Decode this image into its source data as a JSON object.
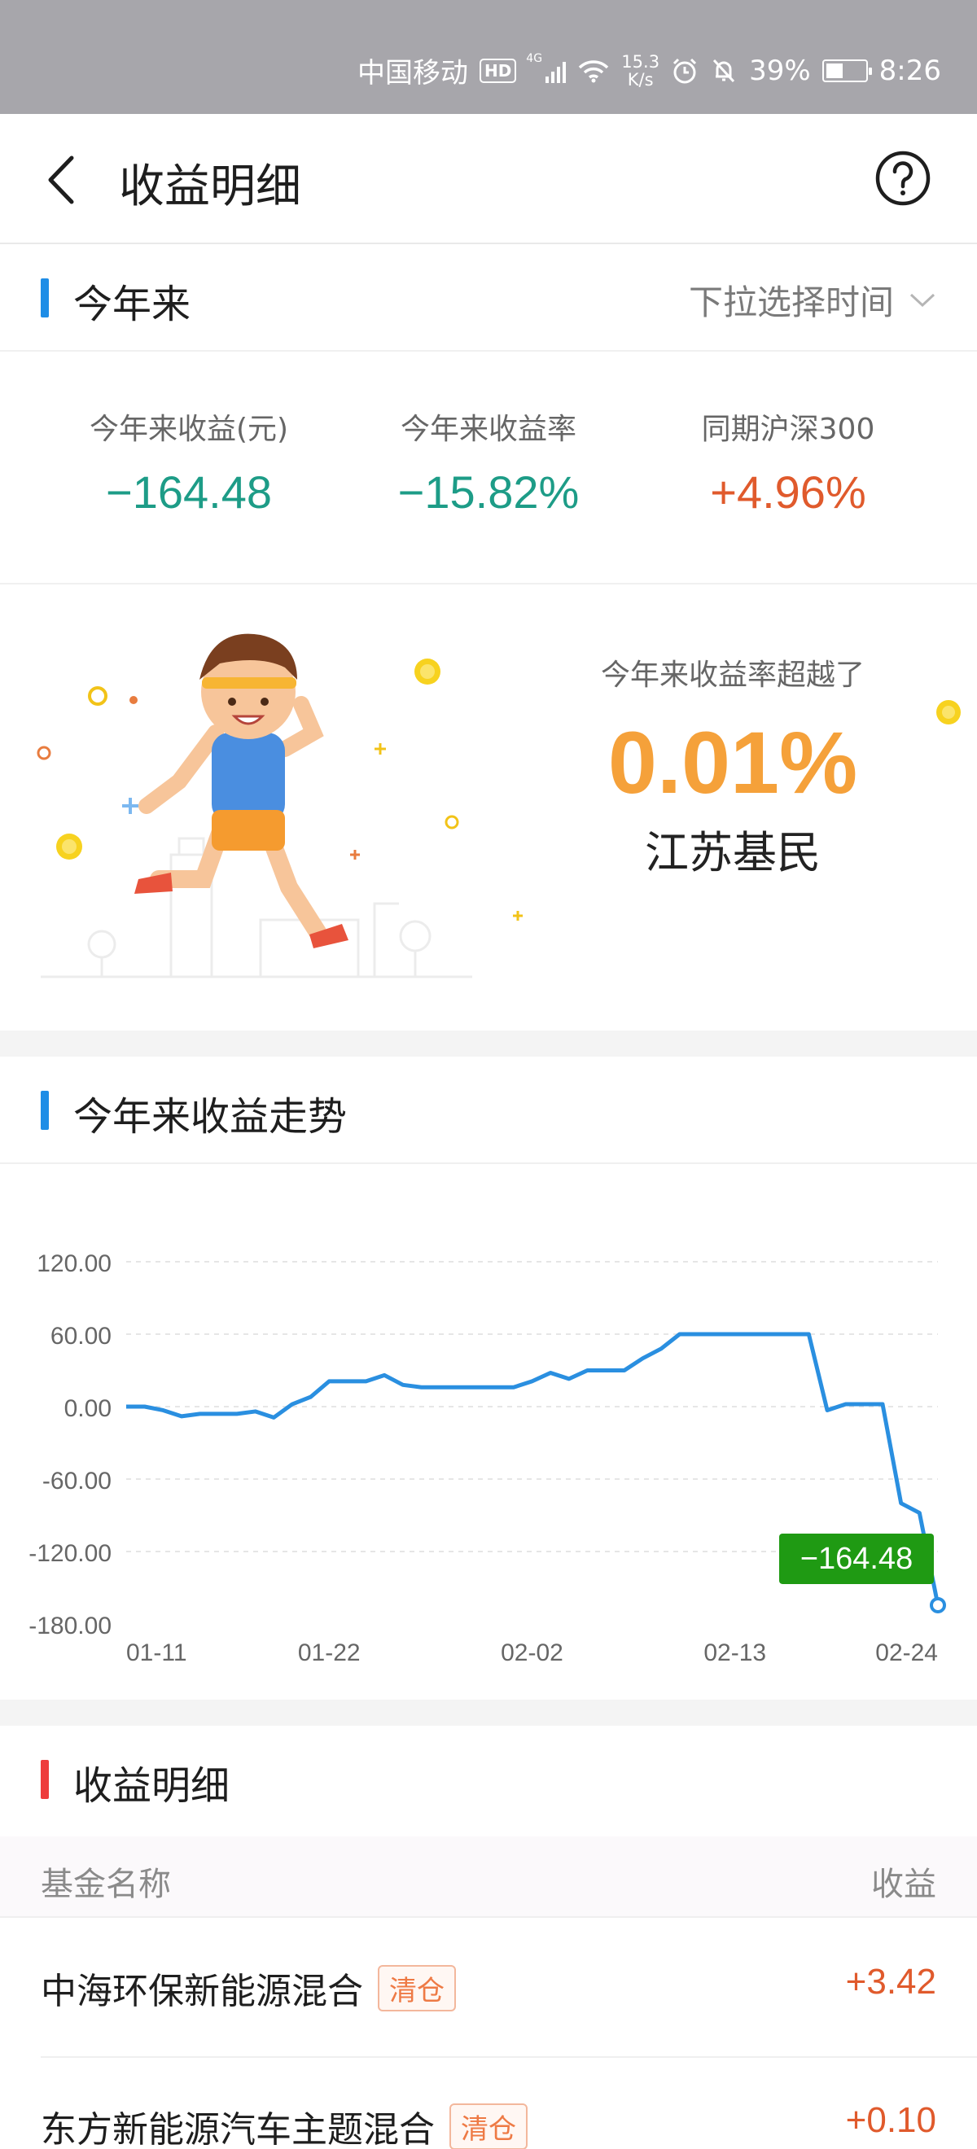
{
  "status_bar": {
    "carrier": "中国移动",
    "hd": "HD",
    "signal_tag": "4G",
    "net_speed_value": "15.3",
    "net_speed_unit": "K/s",
    "battery": "39%",
    "time": "8:26"
  },
  "nav": {
    "title": "收益明细",
    "back_icon": "chevron-left-icon",
    "help_icon": "question-circle-icon"
  },
  "ytd": {
    "section_title": "今年来",
    "time_picker_label": "下拉选择时间",
    "accent": "#1e8de6",
    "stats": [
      {
        "label": "今年来收益(元)",
        "value": "−164.48",
        "color": "#1d9c87"
      },
      {
        "label": "今年来收益率",
        "value": "−15.82%",
        "color": "#1d9c87"
      },
      {
        "label": "同期沪深300",
        "value": "+4.96%",
        "color": "#e05a2c"
      }
    ]
  },
  "rank": {
    "lead": "今年来收益率超越了",
    "percent": "0.01%",
    "group": "江苏基民"
  },
  "trend": {
    "section_title": "今年来收益走势"
  },
  "chart_data": {
    "type": "line",
    "x_ticks": [
      "01-11",
      "01-22",
      "02-02",
      "02-13",
      "02-24"
    ],
    "y_ticks": [
      "120.00",
      "60.00",
      "0.00",
      "-60.00",
      "-120.00",
      "-180.00"
    ],
    "ylim": [
      -180,
      120
    ],
    "grid": true,
    "line_color": "#2a8fe0",
    "series": [
      {
        "values": [
          0,
          0,
          -3,
          -8,
          -6,
          -6,
          -6,
          -4,
          -9,
          2,
          8,
          21,
          21,
          21,
          26,
          18,
          16,
          16,
          16,
          16,
          16,
          16,
          21,
          28,
          23,
          30,
          30,
          30,
          40,
          48,
          60,
          60,
          60,
          60,
          60,
          60,
          60,
          60,
          -3,
          2,
          2,
          2,
          -80,
          -88,
          -164.48
        ]
      }
    ],
    "end_label": "−164.48",
    "end_label_color": "#1f9a13"
  },
  "details": {
    "section_title": "收益明细",
    "accent": "#ee3c3c",
    "col_name": "基金名称",
    "col_amount": "收益",
    "rows": [
      {
        "name": "中海环保新能源混合",
        "tag": "清仓",
        "amount": "+3.42"
      },
      {
        "name": "东方新能源汽车主题混合",
        "tag": "清仓",
        "amount": "+0.10"
      }
    ]
  }
}
